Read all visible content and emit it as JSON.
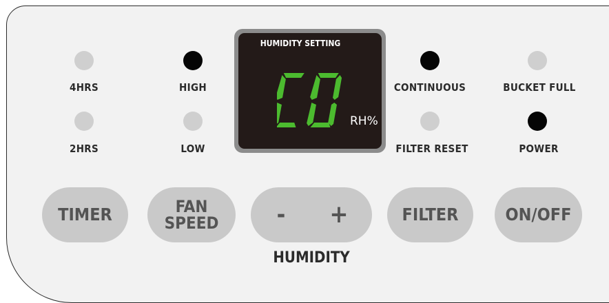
{
  "indicators": {
    "hrs4": {
      "label": "4HRS",
      "lit": false
    },
    "high": {
      "label": "HIGH",
      "lit": true
    },
    "continuous": {
      "label": "CONTINUOUS",
      "lit": true
    },
    "bucket_full": {
      "label": "BUCKET FULL",
      "lit": false
    },
    "hrs2": {
      "label": "2HRS",
      "lit": false
    },
    "low": {
      "label": "LOW",
      "lit": false
    },
    "filter_reset": {
      "label": "FILTER RESET",
      "lit": false
    },
    "power": {
      "label": "POWER",
      "lit": true
    }
  },
  "display": {
    "title": "HUMIDITY SETTING",
    "value": "CO",
    "unit": "RH%",
    "digit_color": "#4cbb2f"
  },
  "buttons": {
    "timer": "TIMER",
    "fan_speed_line1": "FAN",
    "fan_speed_line2": "SPEED",
    "minus": "-",
    "plus": "+",
    "filter": "FILTER",
    "on_off": "ON/OFF"
  },
  "humidity_caption": "HUMIDITY",
  "colors": {
    "led_on": "#050505",
    "led_off": "#cfcfcf",
    "button": "#c9c9c9",
    "panel": "#f2f2f2"
  }
}
